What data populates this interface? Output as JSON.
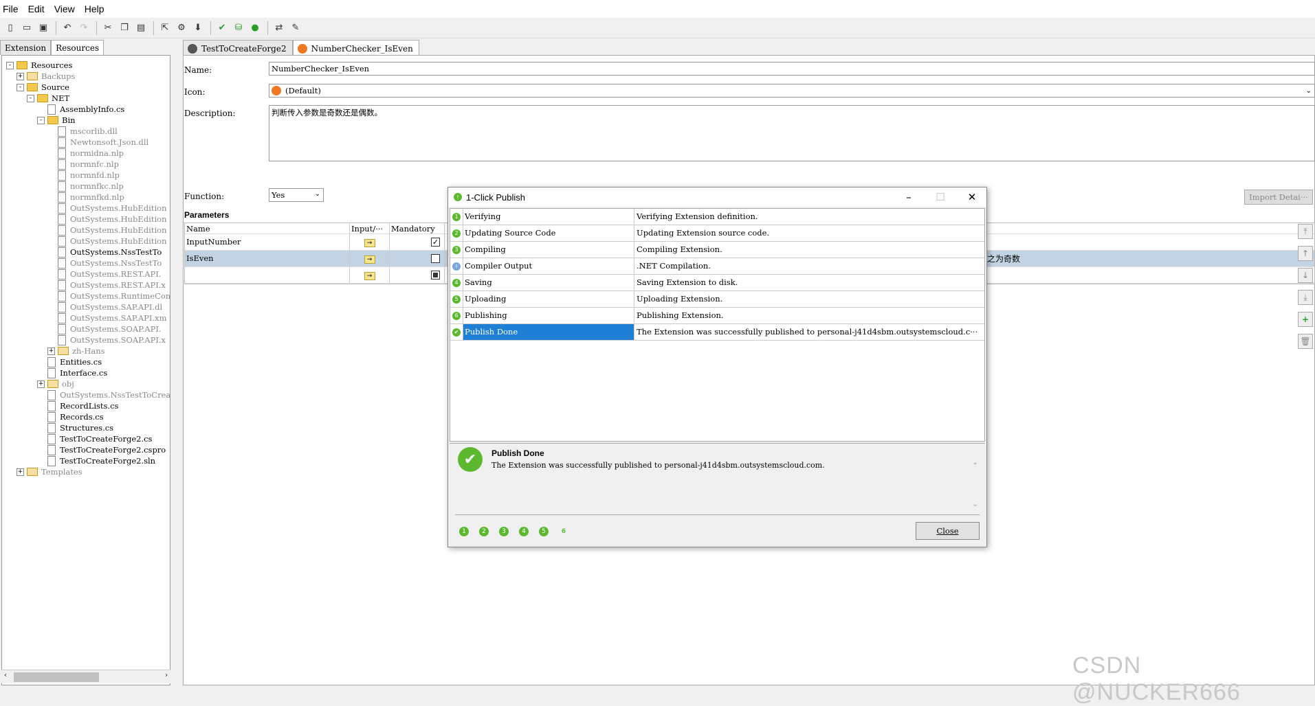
{
  "menu": {
    "file": "File",
    "edit": "Edit",
    "view": "View",
    "help": "Help"
  },
  "left_tabs": {
    "extension": "Extension",
    "resources": "Resources"
  },
  "tree": [
    {
      "label": "Resources",
      "depth": 0,
      "type": "folder",
      "exp": "-",
      "style": ""
    },
    {
      "label": "Backups",
      "depth": 1,
      "type": "folder",
      "exp": "+",
      "style": "dim"
    },
    {
      "label": "Source",
      "depth": 1,
      "type": "folder",
      "exp": "-",
      "style": ""
    },
    {
      "label": "NET",
      "depth": 2,
      "type": "folder",
      "exp": "-",
      "style": ""
    },
    {
      "label": "AssemblyInfo.cs",
      "depth": 3,
      "type": "file",
      "exp": "",
      "style": ""
    },
    {
      "label": "Bin",
      "depth": 3,
      "type": "folder",
      "exp": "-",
      "style": ""
    },
    {
      "label": "mscorlib.dll",
      "depth": 4,
      "type": "file",
      "exp": "",
      "style": "dim"
    },
    {
      "label": "Newtonsoft.Json.dll",
      "depth": 4,
      "type": "file",
      "exp": "",
      "style": "dim"
    },
    {
      "label": "normidna.nlp",
      "depth": 4,
      "type": "file",
      "exp": "",
      "style": "dim"
    },
    {
      "label": "normnfc.nlp",
      "depth": 4,
      "type": "file",
      "exp": "",
      "style": "dim"
    },
    {
      "label": "normnfd.nlp",
      "depth": 4,
      "type": "file",
      "exp": "",
      "style": "dim"
    },
    {
      "label": "normnfkc.nlp",
      "depth": 4,
      "type": "file",
      "exp": "",
      "style": "dim"
    },
    {
      "label": "normnfkd.nlp",
      "depth": 4,
      "type": "file",
      "exp": "",
      "style": "dim"
    },
    {
      "label": "OutSystems.HubEdition",
      "depth": 4,
      "type": "file",
      "exp": "",
      "style": "dim"
    },
    {
      "label": "OutSystems.HubEdition",
      "depth": 4,
      "type": "file",
      "exp": "",
      "style": "dim"
    },
    {
      "label": "OutSystems.HubEdition",
      "depth": 4,
      "type": "file",
      "exp": "",
      "style": "dim"
    },
    {
      "label": "OutSystems.HubEdition",
      "depth": 4,
      "type": "file",
      "exp": "",
      "style": "dim"
    },
    {
      "label": "OutSystems.NssTestTo",
      "depth": 4,
      "type": "file",
      "exp": "",
      "style": ""
    },
    {
      "label": "OutSystems.NssTestTo",
      "depth": 4,
      "type": "file",
      "exp": "",
      "style": "dim"
    },
    {
      "label": "OutSystems.REST.API.",
      "depth": 4,
      "type": "file",
      "exp": "",
      "style": "dim"
    },
    {
      "label": "OutSystems.REST.API.x",
      "depth": 4,
      "type": "file",
      "exp": "",
      "style": "dim"
    },
    {
      "label": "OutSystems.RuntimeCom",
      "depth": 4,
      "type": "file",
      "exp": "",
      "style": "dim"
    },
    {
      "label": "OutSystems.SAP.API.dl",
      "depth": 4,
      "type": "file",
      "exp": "",
      "style": "dim"
    },
    {
      "label": "OutSystems.SAP.API.xm",
      "depth": 4,
      "type": "file",
      "exp": "",
      "style": "dim"
    },
    {
      "label": "OutSystems.SOAP.API.",
      "depth": 4,
      "type": "file",
      "exp": "",
      "style": "dim"
    },
    {
      "label": "OutSystems.SOAP.API.x",
      "depth": 4,
      "type": "file",
      "exp": "",
      "style": "dim"
    },
    {
      "label": "zh-Hans",
      "depth": 4,
      "type": "folder",
      "exp": "+",
      "style": "dim"
    },
    {
      "label": "Entities.cs",
      "depth": 3,
      "type": "file",
      "exp": "",
      "style": ""
    },
    {
      "label": "Interface.cs",
      "depth": 3,
      "type": "file",
      "exp": "",
      "style": ""
    },
    {
      "label": "obj",
      "depth": 3,
      "type": "folder",
      "exp": "+",
      "style": "dim"
    },
    {
      "label": "OutSystems.NssTestToCrea",
      "depth": 3,
      "type": "file",
      "exp": "",
      "style": "dim"
    },
    {
      "label": "RecordLists.cs",
      "depth": 3,
      "type": "file",
      "exp": "",
      "style": ""
    },
    {
      "label": "Records.cs",
      "depth": 3,
      "type": "file",
      "exp": "",
      "style": ""
    },
    {
      "label": "Structures.cs",
      "depth": 3,
      "type": "file",
      "exp": "",
      "style": ""
    },
    {
      "label": "TestToCreateForge2.cs",
      "depth": 3,
      "type": "file",
      "exp": "",
      "style": ""
    },
    {
      "label": "TestToCreateForge2.cspro",
      "depth": 3,
      "type": "file",
      "exp": "",
      "style": ""
    },
    {
      "label": "TestToCreateForge2.sln",
      "depth": 3,
      "type": "file",
      "exp": "",
      "style": ""
    },
    {
      "label": "Templates",
      "depth": 1,
      "type": "folder",
      "exp": "+",
      "style": "dim"
    }
  ],
  "doc_tabs": [
    {
      "label": "TestToCreateForge2",
      "color": "#555555"
    },
    {
      "label": "NumberChecker_IsEven",
      "color": "#ee7722"
    }
  ],
  "form": {
    "name_label": "Name:",
    "name_value": "NumberChecker_IsEven",
    "icon_label": "Icon:",
    "icon_value": "(Default)",
    "desc_label": "Description:",
    "desc_value": "判断传入参数是奇数还是偶数。",
    "func_label": "Function:",
    "func_value": "Yes",
    "import_label": "Import Detai···"
  },
  "parameters": {
    "title": "Parameters",
    "headers": [
      "Name",
      "Input/···",
      "Mandatory"
    ],
    "rows": [
      {
        "name": "InputNumber",
        "mandatory": "checked"
      },
      {
        "name": "IsEven",
        "mandatory": "unchecked",
        "desc": "之为奇数"
      },
      {
        "name": "",
        "mandatory": "filled"
      }
    ]
  },
  "dialog": {
    "title": "1-Click Publish",
    "steps": [
      {
        "num": "1",
        "name": "Verifying",
        "detail": "Verifying Extension definition.",
        "kind": "green"
      },
      {
        "num": "2",
        "name": "Updating Source Code",
        "detail": "Updating Extension source code.",
        "kind": "green"
      },
      {
        "num": "3",
        "name": "Compiling",
        "detail": "Compiling Extension.",
        "kind": "green"
      },
      {
        "num": "i",
        "name": "Compiler Output",
        "detail": ".NET Compilation.",
        "kind": "blue"
      },
      {
        "num": "4",
        "name": "Saving",
        "detail": "Saving Extension to disk.",
        "kind": "green"
      },
      {
        "num": "5",
        "name": "Uploading",
        "detail": "Uploading Extension.",
        "kind": "green"
      },
      {
        "num": "6",
        "name": "Publishing",
        "detail": "Publishing Extension.",
        "kind": "green"
      },
      {
        "num": "✔",
        "name": "Publish Done",
        "detail": "The Extension was successfully published to personal-j41d4sbm.outsystemscloud.c···",
        "kind": "green"
      }
    ],
    "done_title": "Publish Done",
    "done_message": "The Extension was successfully published to personal-j41d4sbm.outsystemscloud.com.",
    "progress": [
      "1",
      "2",
      "3",
      "4",
      "5",
      "6"
    ],
    "close_label": "Close"
  },
  "watermark": "CSDN @NUCKER666"
}
